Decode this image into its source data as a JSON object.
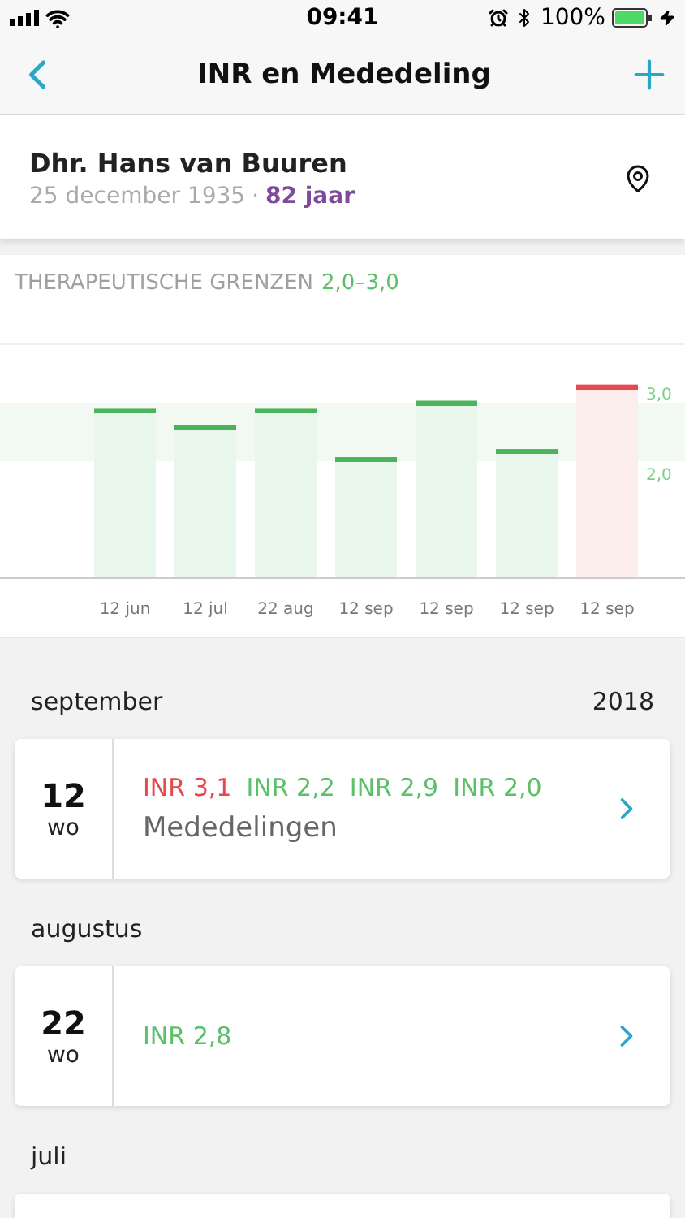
{
  "status_bar": {
    "time": "09:41",
    "battery": "100%"
  },
  "nav": {
    "title": "INR en Mededeling"
  },
  "patient": {
    "name": "Dhr. Hans van Buuren",
    "birth": "25 december 1935",
    "separator": "·",
    "age": "82 jaar"
  },
  "chart": {
    "title": "THERAPEUTISCHE GRENZEN",
    "range": "2,0–3,0",
    "chart_data": {
      "type": "bar",
      "categories": [
        "12 jun",
        "12 jul",
        "22 aug",
        "12 sep",
        "12 sep",
        "12 sep",
        "12 sep"
      ],
      "values": [
        2.8,
        2.6,
        2.8,
        2.2,
        2.9,
        2.3,
        3.1
      ],
      "ylim": [
        0.7,
        3.6
      ],
      "yticks": [
        {
          "value": 2,
          "label": "2,0"
        },
        {
          "value": 3,
          "label": "3,0"
        }
      ]
    }
  },
  "sections": [
    {
      "month": "september",
      "year": "2018",
      "entries": [
        {
          "day": "12",
          "weekday": "wo",
          "readings": [
            {
              "text": "INR 3,1",
              "kind": "high"
            },
            {
              "text": "INR 2,2",
              "kind": "normal"
            },
            {
              "text": "INR 2,9",
              "kind": "normal"
            },
            {
              "text": "INR 2,0",
              "kind": "normal"
            }
          ],
          "note": "Mededelingen"
        }
      ]
    },
    {
      "month": "augustus",
      "entries": [
        {
          "day": "22",
          "weekday": "wo",
          "readings": [
            {
              "text": "INR 2,8",
              "kind": "normal"
            }
          ]
        }
      ]
    },
    {
      "month": "juli"
    }
  ]
}
